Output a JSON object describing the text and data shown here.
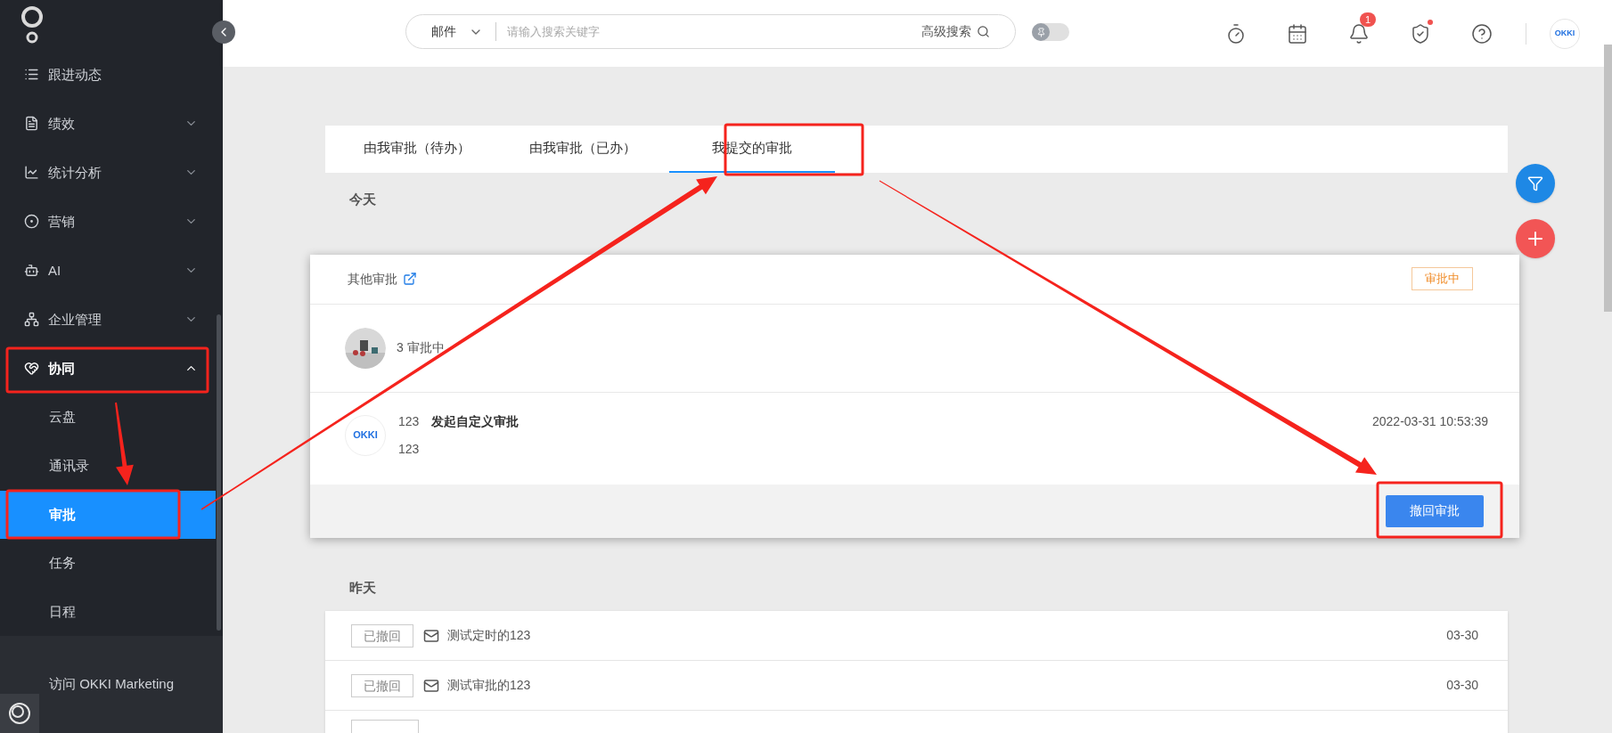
{
  "sidebar": {
    "items": [
      {
        "label": "跟进动态",
        "kind": "link"
      },
      {
        "label": "绩效",
        "kind": "group",
        "expanded": false
      },
      {
        "label": "统计分析",
        "kind": "group",
        "expanded": false
      },
      {
        "label": "营销",
        "kind": "group",
        "expanded": false
      },
      {
        "label": "AI",
        "kind": "group",
        "expanded": false
      },
      {
        "label": "企业管理",
        "kind": "group",
        "expanded": false
      },
      {
        "label": "协同",
        "kind": "group",
        "expanded": true,
        "children": [
          {
            "label": "云盘",
            "selected": false
          },
          {
            "label": "通讯录",
            "selected": false
          },
          {
            "label": "审批",
            "selected": true
          },
          {
            "label": "任务",
            "selected": false
          },
          {
            "label": "日程",
            "selected": false
          }
        ]
      }
    ],
    "footer_link": "访问 OKKI Marketing"
  },
  "topbar": {
    "search": {
      "scope": "邮件",
      "placeholder": "请输入搜索关键字",
      "advanced": "高级搜索"
    },
    "toggle": {
      "on": false
    },
    "icons": [
      {
        "kind": "timer"
      },
      {
        "kind": "calendar"
      },
      {
        "kind": "bell",
        "badge": "1"
      },
      {
        "kind": "shield",
        "dot": true
      },
      {
        "kind": "help"
      }
    ],
    "avatar": "OKKI"
  },
  "tabs": [
    {
      "label": "由我审批（待办）",
      "selected": false
    },
    {
      "label": "由我审批（已办）",
      "selected": false
    },
    {
      "label": "我提交的审批",
      "selected": true
    }
  ],
  "today": {
    "title": "今天",
    "card": {
      "source": "其他审批",
      "status": "审批中",
      "progress": "3 审批中",
      "entry": {
        "avatar": "OKKI",
        "author": "123",
        "title": "发起自定义审批",
        "time": "2022-03-31 10:53:39",
        "body": "123"
      },
      "action": "撤回审批"
    }
  },
  "yesterday": {
    "title": "昨天",
    "rows": [
      {
        "status": "已撤回",
        "title": "测试定时的123",
        "date": "03-30"
      },
      {
        "status": "已撤回",
        "title": "测试审批的123",
        "date": "03-30"
      }
    ]
  }
}
